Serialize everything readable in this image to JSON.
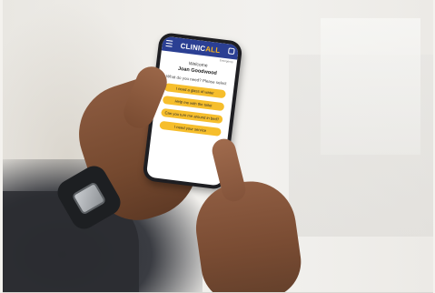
{
  "app": {
    "logo_main": "CLINIC",
    "logo_accent": "ALL",
    "top_note": "Emergency",
    "welcome": "Welcome",
    "user_name": "Joan Goodwood",
    "prompt": "What do you need? Please select"
  },
  "options": [
    "I need a glass of water",
    "Help me with the toilet",
    "Can you turn me around in bed?",
    "I need your service"
  ],
  "colors": {
    "app_bar": "#2b3f93",
    "option_button": "#f6be2c",
    "logo_accent": "#f7b51f"
  }
}
